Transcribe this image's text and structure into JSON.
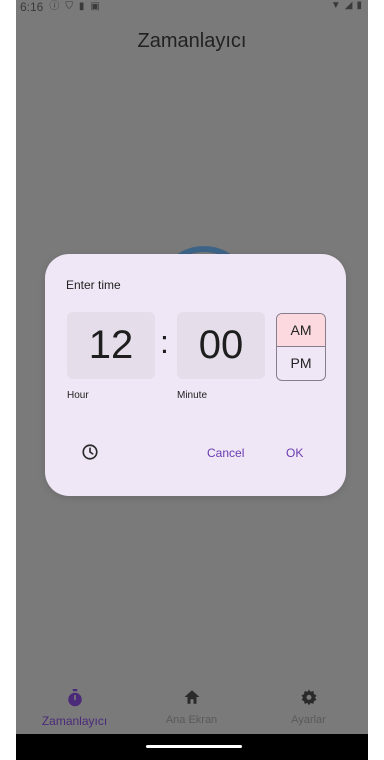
{
  "status_bar": {
    "time": "6:16"
  },
  "app_bar": {
    "title": "Zamanlayıcı"
  },
  "time_picker": {
    "title": "Enter time",
    "hour": "12",
    "minute": "00",
    "separator": ":",
    "hour_label": "Hour",
    "minute_label": "Minute",
    "am": "AM",
    "pm": "PM",
    "selected_period": "AM",
    "cancel": "Cancel",
    "ok": "OK"
  },
  "bottom_nav": {
    "items": [
      {
        "label": "Zamanlayıcı",
        "icon": "stopwatch-icon",
        "active": true
      },
      {
        "label": "Ana Ekran",
        "icon": "home-icon",
        "active": false
      },
      {
        "label": "Ayarlar",
        "icon": "gear-icon",
        "active": false
      }
    ]
  },
  "colors": {
    "scrim": "#7a7a7a",
    "dialog_bg": "#efe6f6",
    "field_bg": "#e5dde9",
    "accent": "#6a3bb0",
    "am_selected": "#fcd9df"
  }
}
